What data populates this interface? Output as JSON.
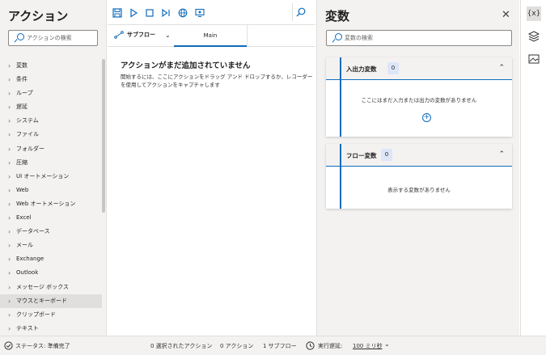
{
  "actions_panel": {
    "title": "アクション",
    "search_placeholder": "アクションの検索",
    "categories": [
      {
        "label": "変数"
      },
      {
        "label": "条件"
      },
      {
        "label": "ループ"
      },
      {
        "label": "遅延"
      },
      {
        "label": "システム"
      },
      {
        "label": "ファイル"
      },
      {
        "label": "フォルダー"
      },
      {
        "label": "圧縮"
      },
      {
        "label": "UI オートメーション"
      },
      {
        "label": "Web"
      },
      {
        "label": "Web オートメーション"
      },
      {
        "label": "Excel"
      },
      {
        "label": "データベース"
      },
      {
        "label": "メール"
      },
      {
        "label": "Exchange"
      },
      {
        "label": "Outlook"
      },
      {
        "label": "メッセージ ボックス"
      },
      {
        "label": "マウスとキーボード",
        "selected": true
      },
      {
        "label": "クリップボード"
      },
      {
        "label": "テキスト"
      }
    ]
  },
  "editor": {
    "subflow_label": "サブフロー",
    "tab_main": "Main",
    "empty_title": "アクションがまだ追加されていません",
    "empty_desc": "開始するには、ここにアクションをドラッグ アンド ドロップするか、レコーダーを使用してアクションをキャプチャします"
  },
  "variables_panel": {
    "title": "変数",
    "search_placeholder": "変数の検索",
    "io_title": "入出力変数",
    "io_count": "0",
    "io_empty": "ここにはまだ入力または出力の変数がありません",
    "flow_title": "フロー変数",
    "flow_count": "0",
    "flow_empty": "表示する変数がありません"
  },
  "rail": {
    "vars_icon_text": "{x}"
  },
  "status_bar": {
    "status": "ステータス: 準備完了",
    "selected_actions": "0 選択されたアクション",
    "actions": "0 アクション",
    "subflows": "1 サブフロー",
    "delay_label": "実行遅延:",
    "delay_value": "100 ミリ秒"
  },
  "colors": {
    "accent": "#0f6cbd",
    "panel_bg": "#f3f2f1",
    "selected": "#e1dfdd"
  }
}
